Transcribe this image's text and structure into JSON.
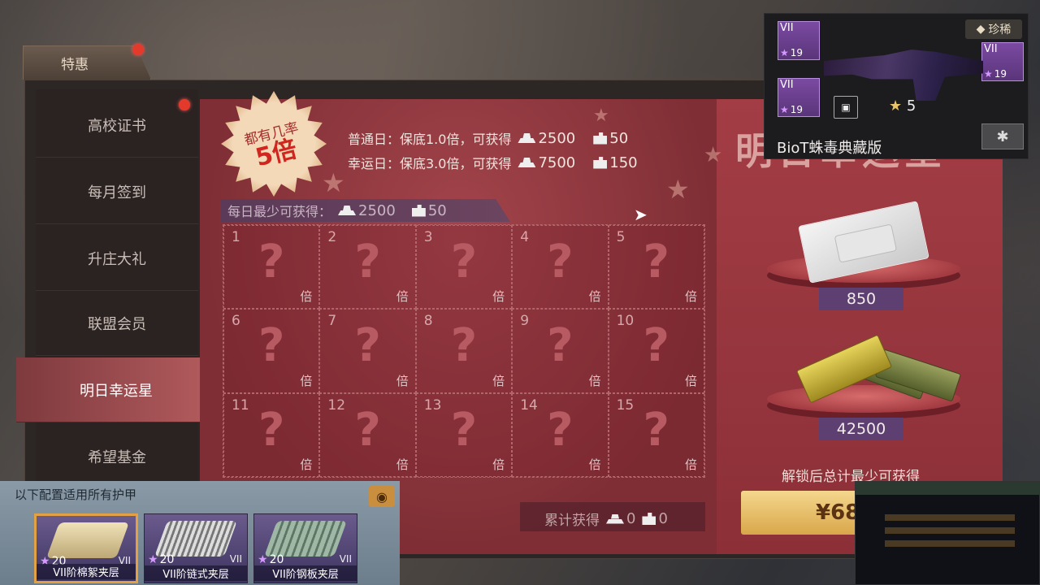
{
  "tab": {
    "label": "特惠"
  },
  "sidebar": {
    "items": [
      {
        "label": "高校证书"
      },
      {
        "label": "每月签到"
      },
      {
        "label": "升庄大礼"
      },
      {
        "label": "联盟会员"
      },
      {
        "label": "明日幸运星"
      },
      {
        "label": "希望基金"
      }
    ]
  },
  "promo": {
    "line1": "都有几率",
    "line2": "5倍"
  },
  "info": {
    "normal": {
      "label": "普通日：保底1.0倍，可获得",
      "gold": "2500",
      "pc": "50"
    },
    "lucky": {
      "label": "幸运日：保底3.0倍，可获得",
      "gold": "7500",
      "pc": "150"
    }
  },
  "min_daily": {
    "label": "每日最少可获得：",
    "gold": "2500",
    "pc": "50"
  },
  "grid": {
    "cells": [
      "1",
      "2",
      "3",
      "4",
      "5",
      "6",
      "7",
      "8",
      "9",
      "10",
      "11",
      "12",
      "13",
      "14",
      "15"
    ],
    "q": "?",
    "unit": "倍"
  },
  "total": {
    "label": "累计获得",
    "gold": "0",
    "pc": "0"
  },
  "right": {
    "title": "明日幸运星",
    "reward1": "850",
    "reward2": "42500",
    "unlock_text": "解锁后总计最少可获得",
    "buy_label": "¥68"
  },
  "weapon": {
    "rarity": "珍稀",
    "name": "BioT蛛毒典藏版",
    "stars": "5",
    "slots": [
      {
        "tier": "VII",
        "rank": "19"
      },
      {
        "tier": "VII",
        "rank": "19"
      },
      {
        "tier": "VII",
        "rank": "19"
      }
    ]
  },
  "armor": {
    "title": "以下配置适用所有护甲",
    "items": [
      {
        "level": "20",
        "tier": "VII",
        "name": "VII阶棉絮夹层"
      },
      {
        "level": "20",
        "tier": "VII",
        "name": "VII阶链式夹层"
      },
      {
        "level": "20",
        "tier": "VII",
        "name": "VII阶钢板夹层"
      }
    ]
  },
  "colors": {
    "accent_red": "#a3444b",
    "gold_button": "#f4d78e",
    "purple_tag": "#5d3f72"
  }
}
